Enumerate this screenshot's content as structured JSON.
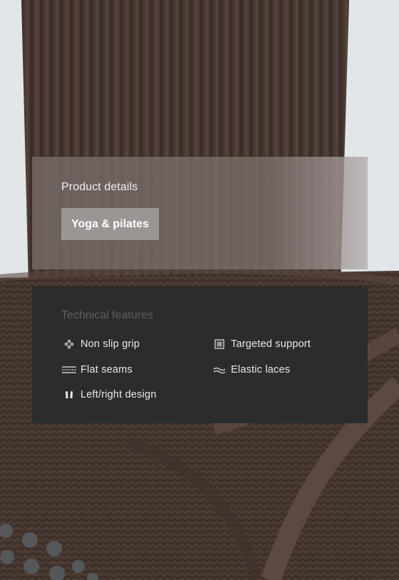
{
  "details": {
    "title": "Product details",
    "tag": "Yoga & pilates"
  },
  "features": {
    "title": "Technical features",
    "items": [
      {
        "label": "Non slip grip",
        "icon": "grip-dots-icon"
      },
      {
        "label": "Targeted support",
        "icon": "support-square-icon"
      },
      {
        "label": "Flat seams",
        "icon": "flat-seams-icon"
      },
      {
        "label": "Elastic laces",
        "icon": "wave-icon"
      },
      {
        "label": "Left/right design",
        "icon": "feet-icon"
      }
    ]
  },
  "colors": {
    "knit_brown": "#4a3a33",
    "features_panel": "#2c2c2c",
    "details_panel": "#726561",
    "tag_chip": "#9b9593"
  }
}
